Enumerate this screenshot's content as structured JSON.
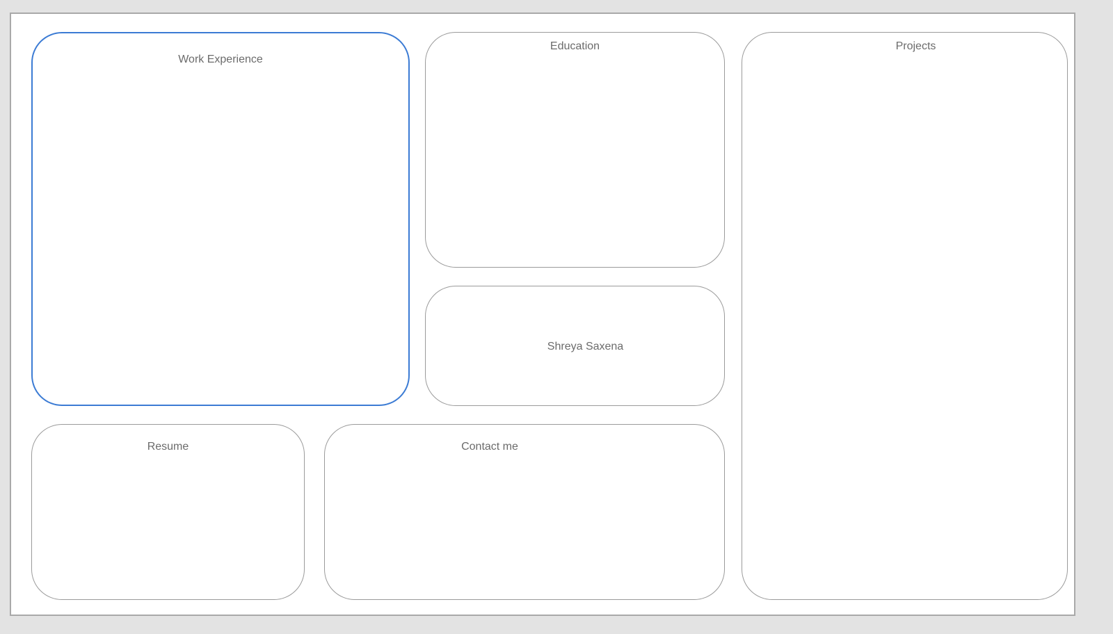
{
  "cards": {
    "work_experience": {
      "title": "Work Experience",
      "selected": true
    },
    "education": {
      "title": "Education"
    },
    "name": {
      "title": "Shreya Saxena"
    },
    "projects": {
      "title": "Projects"
    },
    "resume": {
      "title": "Resume"
    },
    "contact": {
      "title": "Contact me"
    }
  },
  "colors": {
    "background": "#e3e3e3",
    "canvas": "#ffffff",
    "card_border": "#9a9a9a",
    "selected_border": "#3b7bd4",
    "title_text": "#6b6b6b"
  }
}
